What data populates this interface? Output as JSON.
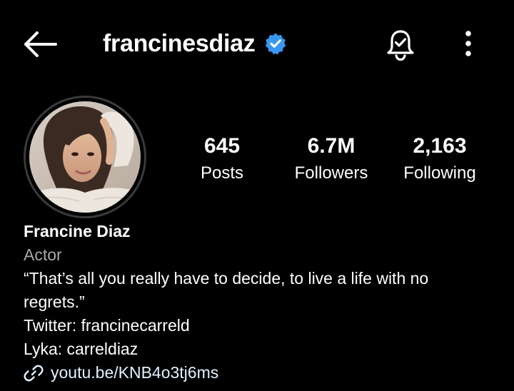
{
  "header": {
    "username": "francinesdiaz",
    "verified": true,
    "icons": [
      "back-arrow-icon",
      "verified-badge-icon",
      "notification-bell-icon",
      "more-options-icon"
    ]
  },
  "stats": [
    {
      "value": "645",
      "label": "Posts"
    },
    {
      "value": "6.7M",
      "label": "Followers"
    },
    {
      "value": "2,163",
      "label": "Following"
    }
  ],
  "profile": {
    "display_name": "Francine Diaz",
    "category": "Actor",
    "bio_quote": "“That’s all you really have to decide, to live a life with no regrets.”",
    "twitter": "Twitter: francinecarreld",
    "lyka": "Lyka: carreldiaz",
    "link": "youtu.be/KNB4o3tj6ms"
  },
  "colors": {
    "background": "#000000",
    "text": "#ffffff",
    "muted": "#a8a8a8",
    "verified": "#3897f0",
    "link": "#e0f1ff"
  }
}
